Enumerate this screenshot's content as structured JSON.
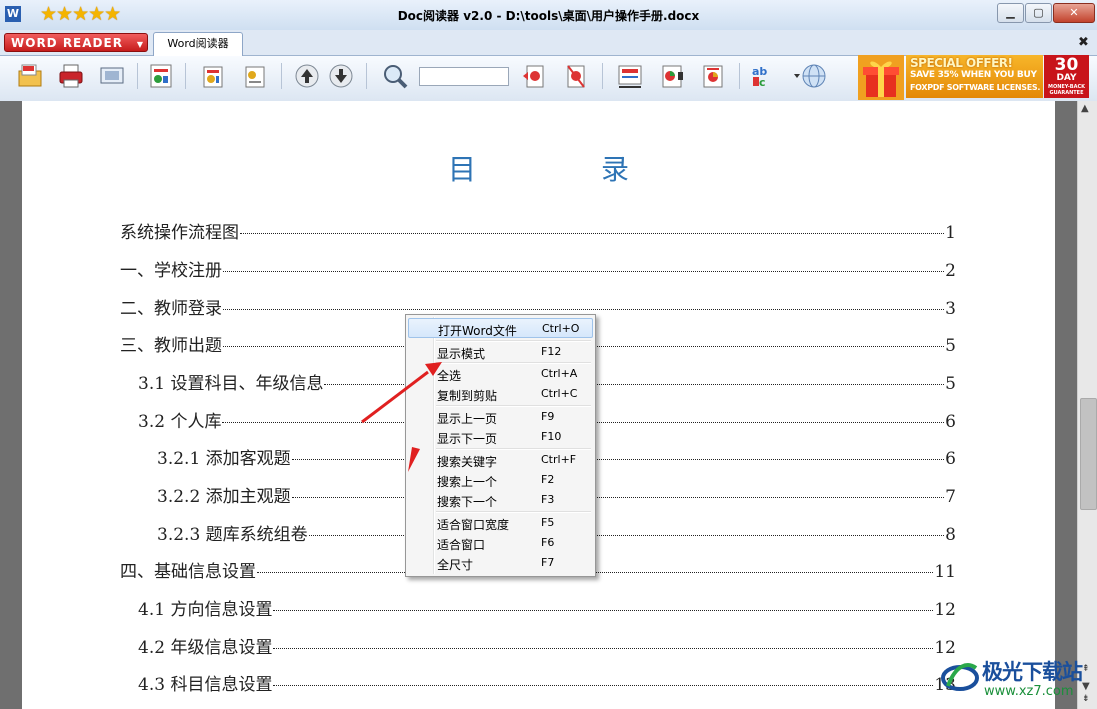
{
  "app": {
    "title": "Doc阅读器 v2.0 - D:\\tools\\桌面\\用户操作手册.docx",
    "icon_letter": "W",
    "rating_stars": "★★★★★",
    "window_buttons": {
      "minimize": "▁",
      "maximize": "▢",
      "close": "✕"
    }
  },
  "tabs": {
    "brand_label": "WORD READER",
    "brand_arrow": "▼",
    "active_tab": "Word阅读器",
    "close_all": "✖"
  },
  "toolbar": {
    "icons": [
      "open-doc-icon",
      "print-icon",
      "screen-icon",
      "page-view-icon",
      "fit-page-icon",
      "text-page-icon",
      "prev-arrow-icon",
      "next-arrow-icon",
      "zoom-icon",
      "first-page-icon",
      "last-page-icon",
      "bookmark-icon",
      "chart-page-icon",
      "pie-page-icon",
      "abc-spell-icon",
      "globe-icon"
    ],
    "search_value": ""
  },
  "promo": {
    "title": "SPECIAL OFFER!",
    "line1": "SAVE 35% WHEN YOU BUY",
    "line2": "FOXPDF SOFTWARE LICENSES.",
    "badge_number": "30",
    "badge_unit": "DAY",
    "badge_sub": "MONEY-BACK GUARANTEE"
  },
  "document": {
    "toc_heading_chars": [
      "目",
      "录"
    ],
    "toc": [
      {
        "label": "系统操作流程图",
        "page": "1"
      },
      {
        "label": "一、学校注册",
        "page": "2"
      },
      {
        "label": "二、教师登录",
        "page": "3"
      },
      {
        "label": "三、教师出题",
        "page": "5"
      },
      {
        "label": "3.1  设置科目、年级信息",
        "page": "5"
      },
      {
        "label": "3.2  个人库",
        "page": "6"
      },
      {
        "label": "3.2.1  添加客观题",
        "page": "6"
      },
      {
        "label": "3.2.2  添加主观题",
        "page": "7"
      },
      {
        "label": "3.2.3  题库系统组卷",
        "page": "8"
      },
      {
        "label": "四、基础信息设置",
        "page": "11"
      },
      {
        "label": "4.1  方向信息设置",
        "page": "12"
      },
      {
        "label": "4.2  年级信息设置",
        "page": "12"
      },
      {
        "label": "4.3  科目信息设置",
        "page": "13"
      }
    ]
  },
  "context_menu": {
    "items": [
      {
        "label": "打开Word文件",
        "shortcut": "Ctrl+O"
      },
      {
        "label": "显示模式",
        "shortcut": "F12"
      },
      {
        "label": "全选",
        "shortcut": "Ctrl+A"
      },
      {
        "label": "复制到剪贴",
        "shortcut": "Ctrl+C"
      },
      {
        "label": "显示上一页",
        "shortcut": "F9"
      },
      {
        "label": "显示下一页",
        "shortcut": "F10"
      },
      {
        "label": "搜索关键字",
        "shortcut": "Ctrl+F"
      },
      {
        "label": "搜索上一个",
        "shortcut": "F2"
      },
      {
        "label": "搜索下一个",
        "shortcut": "F3"
      },
      {
        "label": "适合窗口宽度",
        "shortcut": "F5"
      },
      {
        "label": "适合窗口",
        "shortcut": "F6"
      },
      {
        "label": "全尺寸",
        "shortcut": "F7"
      }
    ],
    "highlighted_index": 0
  },
  "scrollbar": {
    "up": "▲",
    "down": "▼",
    "page_up": "⇞",
    "page_down": "⇟"
  },
  "watermark": {
    "name": "极光下载站",
    "url": "www.xz7.com"
  },
  "colors": {
    "heading_blue": "#2e74b5",
    "annotation_red": "#e02020",
    "brand_red": "#c61c1c"
  }
}
